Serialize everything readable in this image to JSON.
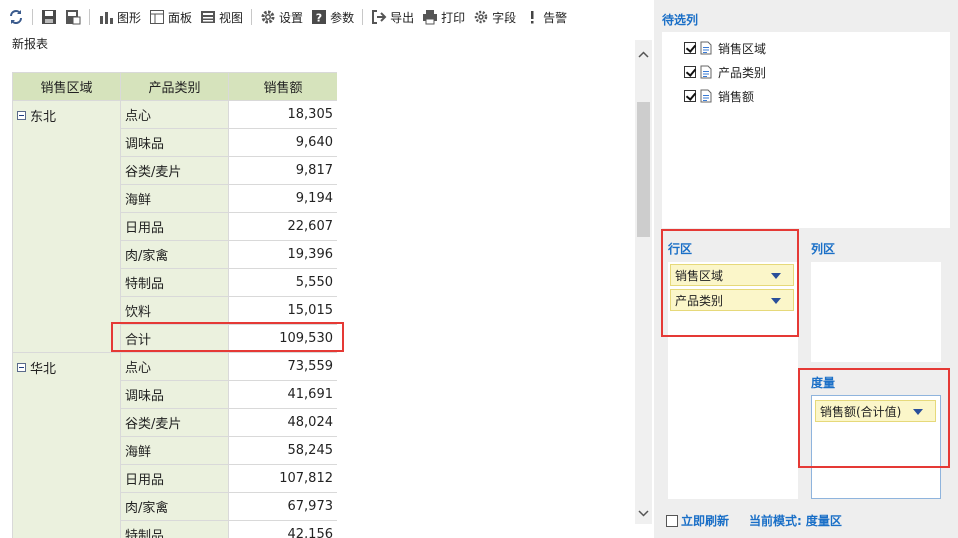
{
  "toolbar": {
    "items": [
      {
        "icon": "refresh-icon",
        "label": ""
      },
      {
        "icon": "save-icon",
        "label": ""
      },
      {
        "icon": "save-as-icon",
        "label": ""
      },
      {
        "icon": "chart-icon",
        "label": "图形"
      },
      {
        "icon": "panel-icon",
        "label": "面板"
      },
      {
        "icon": "view-icon",
        "label": "视图"
      },
      {
        "icon": "gear-icon",
        "label": "设置"
      },
      {
        "icon": "help-icon",
        "label": "参数"
      },
      {
        "icon": "export-icon",
        "label": "导出"
      },
      {
        "icon": "print-icon",
        "label": "打印"
      },
      {
        "icon": "fields-icon",
        "label": "字段"
      },
      {
        "icon": "alert-icon",
        "label": "告警"
      }
    ]
  },
  "report": {
    "title": "新报表",
    "headers": [
      "销售区域",
      "产品类别",
      "销售额"
    ],
    "groups": [
      {
        "region": "东北",
        "rows": [
          {
            "cat": "点心",
            "val": "18,305"
          },
          {
            "cat": "调味品",
            "val": "9,640"
          },
          {
            "cat": "谷类/麦片",
            "val": "9,817"
          },
          {
            "cat": "海鲜",
            "val": "9,194"
          },
          {
            "cat": "日用品",
            "val": "22,607"
          },
          {
            "cat": "肉/家禽",
            "val": "19,396"
          },
          {
            "cat": "特制品",
            "val": "5,550"
          },
          {
            "cat": "饮料",
            "val": "15,015"
          },
          {
            "cat": "合计",
            "val": "109,530"
          }
        ]
      },
      {
        "region": "华北",
        "rows": [
          {
            "cat": "点心",
            "val": "73,559"
          },
          {
            "cat": "调味品",
            "val": "41,691"
          },
          {
            "cat": "谷类/麦片",
            "val": "48,024"
          },
          {
            "cat": "海鲜",
            "val": "58,245"
          },
          {
            "cat": "日用品",
            "val": "107,812"
          },
          {
            "cat": "肉/家禽",
            "val": "67,973"
          },
          {
            "cat": "特制品",
            "val": "42,156"
          }
        ]
      }
    ]
  },
  "panel": {
    "candidates_title": "待选列",
    "candidates": [
      {
        "label": "销售区域",
        "checked": true
      },
      {
        "label": "产品类别",
        "checked": true
      },
      {
        "label": "销售额",
        "checked": true
      }
    ],
    "row_zone_title": "行区",
    "row_fields": [
      "销售区域",
      "产品类别"
    ],
    "col_zone_title": "列区",
    "measure_title": "度量",
    "measure_fields": [
      "销售额(合计值)"
    ],
    "auto_refresh_label": "立即刷新",
    "mode_label": "当前模式:",
    "mode_value": "度量区"
  },
  "colors": {
    "header_bg": "#d6e3bc",
    "dim_bg": "#ebf1de",
    "accent": "#1a6fc7",
    "highlight": "#e53935",
    "field_bg": "#fbf6c9"
  }
}
